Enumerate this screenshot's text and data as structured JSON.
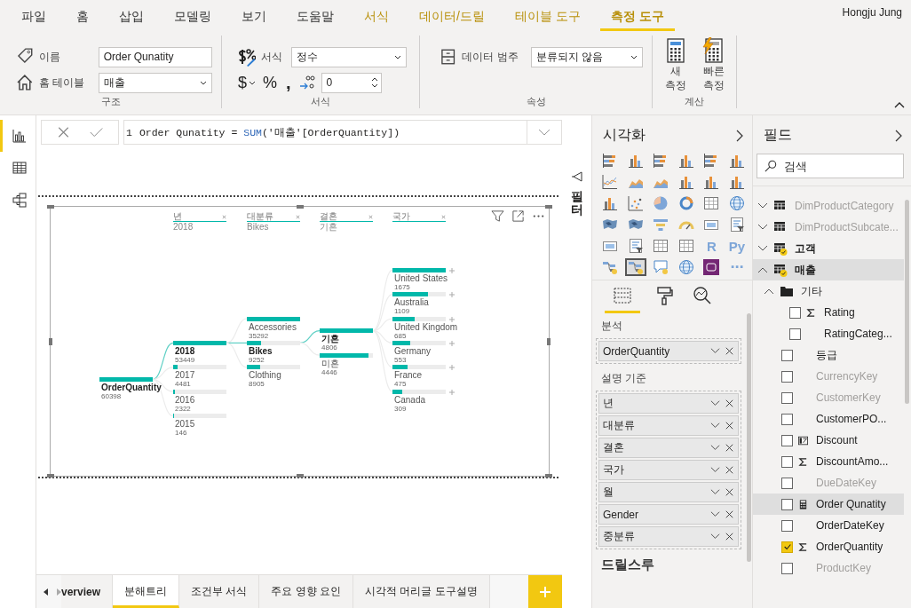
{
  "ribbon": {
    "tabs": [
      {
        "label": "파일",
        "contextual": false,
        "selected": false
      },
      {
        "label": "홈",
        "contextual": false,
        "selected": false
      },
      {
        "label": "삽입",
        "contextual": false,
        "selected": false
      },
      {
        "label": "모델링",
        "contextual": false,
        "selected": false
      },
      {
        "label": "보기",
        "contextual": false,
        "selected": false
      },
      {
        "label": "도움말",
        "contextual": false,
        "selected": false
      },
      {
        "label": "서식",
        "contextual": true,
        "selected": false
      },
      {
        "label": "데이터/드릴",
        "contextual": true,
        "selected": false
      },
      {
        "label": "테이블 도구",
        "contextual": true,
        "selected": false
      },
      {
        "label": "측정 도구",
        "contextual": true,
        "selected": true
      }
    ],
    "user": "Hongju Jung",
    "structure": {
      "label": "구조",
      "name_label": "이름",
      "name_value": "Order Qunatity",
      "home_table_label": "홈 테이블",
      "home_table_value": "매출"
    },
    "format": {
      "label": "서식",
      "format_label": "서식",
      "format_value": "정수",
      "currency": "$",
      "percent": "%",
      "comma": ",",
      "decimals_value": "0"
    },
    "properties": {
      "label": "속성",
      "category_label": "데이터 범주",
      "category_value": "분류되지 않음"
    },
    "calculations": {
      "label": "계산",
      "buttons": [
        {
          "label": "새 측정",
          "kind": "new"
        },
        {
          "label": "빠른 측정",
          "kind": "quick"
        }
      ]
    }
  },
  "left_nav": [
    {
      "kind": "report",
      "selected": true
    },
    {
      "kind": "data",
      "selected": false
    },
    {
      "kind": "model",
      "selected": false
    }
  ],
  "formula_bar": {
    "line_number": "1",
    "segments": [
      {
        "text": "Order Qunatity = ",
        "kind": "plain"
      },
      {
        "text": "SUM",
        "kind": "function"
      },
      {
        "text": "('매출'[OrderQuantity])",
        "kind": "plain"
      }
    ]
  },
  "visual": {
    "root": {
      "label": "OrderQuantity",
      "value": "60398",
      "level": 1
    },
    "columns": [
      {
        "header": "년",
        "subtitle": "2018",
        "nodes": [
          {
            "label": "2018",
            "value": "53449",
            "level": 1,
            "selected": true
          },
          {
            "label": "2017",
            "value": "4481",
            "level": 0.08,
            "selected": false
          },
          {
            "label": "2016",
            "value": "2322",
            "level": 0.04,
            "selected": false
          },
          {
            "label": "2015",
            "value": "146",
            "level": 0.005,
            "selected": false
          }
        ]
      },
      {
        "header": "대분류",
        "subtitle": "Bikes",
        "nodes": [
          {
            "label": "Accessories",
            "value": "35292",
            "level": 1,
            "selected": false
          },
          {
            "label": "Bikes",
            "value": "9252",
            "level": 0.26,
            "selected": true
          },
          {
            "label": "Clothing",
            "value": "8905",
            "level": 0.25,
            "selected": false
          }
        ]
      },
      {
        "header": "결혼",
        "subtitle": "기혼",
        "nodes": [
          {
            "label": "기혼",
            "value": "4806",
            "level": 1,
            "selected": true
          },
          {
            "label": "미혼",
            "value": "4446",
            "level": 0.92,
            "selected": false
          }
        ]
      },
      {
        "header": "국가",
        "nodes": [
          {
            "label": "United States",
            "value": "1675",
            "level": 1,
            "selected": false
          },
          {
            "label": "Australia",
            "value": "1109",
            "level": 0.66,
            "selected": false
          },
          {
            "label": "United Kingdom",
            "value": "685",
            "level": 0.41,
            "selected": false
          },
          {
            "label": "Germany",
            "value": "553",
            "level": 0.33,
            "selected": false
          },
          {
            "label": "France",
            "value": "475",
            "level": 0.28,
            "selected": false
          },
          {
            "label": "Canada",
            "value": "309",
            "level": 0.18,
            "selected": false
          }
        ]
      }
    ]
  },
  "filter_pane": {
    "label": "필터"
  },
  "visualizations": {
    "title": "시각화",
    "visuals": [
      {
        "kind": "hbar",
        "selected": false
      },
      {
        "kind": "vbar",
        "selected": false
      },
      {
        "kind": "hbar",
        "selected": false
      },
      {
        "kind": "vbar",
        "selected": false
      },
      {
        "kind": "hbar",
        "selected": false
      },
      {
        "kind": "vbar",
        "selected": false
      },
      {
        "kind": "line",
        "selected": false
      },
      {
        "kind": "area",
        "selected": false
      },
      {
        "kind": "area",
        "selected": false
      },
      {
        "kind": "vbar",
        "selected": false
      },
      {
        "kind": "vbar",
        "selected": false
      },
      {
        "kind": "vbar",
        "selected": false
      },
      {
        "kind": "vbar",
        "selected": false
      },
      {
        "kind": "dots",
        "selected": false
      },
      {
        "kind": "pie",
        "selected": false
      },
      {
        "kind": "donut",
        "selected": false
      },
      {
        "kind": "grid",
        "selected": false
      },
      {
        "kind": "globe",
        "selected": false
      },
      {
        "kind": "map",
        "selected": false
      },
      {
        "kind": "map",
        "selected": false
      },
      {
        "kind": "funnel",
        "selected": false
      },
      {
        "kind": "gauge",
        "selected": false
      },
      {
        "kind": "card",
        "selected": false
      },
      {
        "kind": "list",
        "selected": false
      },
      {
        "kind": "card",
        "selected": false
      },
      {
        "kind": "list",
        "selected": false
      },
      {
        "kind": "grid",
        "selected": false
      },
      {
        "kind": "grid",
        "selected": false
      },
      {
        "kind": "glyph",
        "label": "R",
        "selected": false
      },
      {
        "kind": "glyph",
        "label": "Py",
        "selected": false
      },
      {
        "kind": "tree",
        "selected": false
      },
      {
        "kind": "tree",
        "selected": true
      },
      {
        "kind": "bubble",
        "selected": false
      },
      {
        "kind": "globe",
        "selected": false
      },
      {
        "kind": "app",
        "selected": false
      },
      {
        "kind": "glyph",
        "label": "⋯",
        "selected": false
      }
    ],
    "pane_tabs": [
      {
        "kind": "fields",
        "selected": true
      },
      {
        "kind": "format",
        "selected": false
      },
      {
        "kind": "analytics",
        "selected": false
      }
    ],
    "analyze": {
      "label": "분석",
      "fields": [
        "OrderQuantity"
      ]
    },
    "explain_by": {
      "label": "설명 기준",
      "fields": [
        "년",
        "대분류",
        "결혼",
        "국가",
        "월",
        "Gender",
        "중분류"
      ]
    },
    "drillthrough": "드릴스루"
  },
  "fields": {
    "title": "필드",
    "search": {
      "placeholder": "검색"
    },
    "tree": [
      {
        "kind": "table",
        "name": "DimProductCategory",
        "expanded": false,
        "hidden": true,
        "used": false,
        "selected": false
      },
      {
        "kind": "table",
        "name": "DimProductSubcate...",
        "expanded": false,
        "hidden": true,
        "used": false,
        "selected": false
      },
      {
        "kind": "table",
        "name": "고객",
        "expanded": false,
        "hidden": false,
        "used": true,
        "selected": false
      },
      {
        "kind": "table",
        "name": "매출",
        "expanded": true,
        "hidden": false,
        "used": true,
        "selected": true,
        "children": [
          {
            "kind": "folder",
            "name": "기타",
            "expanded": true,
            "children": [
              {
                "kind": "sum-field",
                "name": "Rating",
                "checked": false,
                "hidden": false,
                "selected": false
              },
              {
                "kind": "field",
                "name": "RatingCateg...",
                "checked": false,
                "hidden": false,
                "selected": false
              }
            ]
          },
          {
            "kind": "field",
            "name": "등급",
            "checked": false,
            "hidden": false,
            "selected": false
          },
          {
            "kind": "field",
            "name": "CurrencyKey",
            "checked": false,
            "hidden": true,
            "selected": false
          },
          {
            "kind": "field",
            "name": "CustomerKey",
            "checked": false,
            "hidden": true,
            "selected": false
          },
          {
            "kind": "field",
            "name": "CustomerPO...",
            "checked": false,
            "hidden": false,
            "selected": false
          },
          {
            "kind": "parameter-field",
            "name": "Discount",
            "checked": false,
            "hidden": false,
            "selected": false
          },
          {
            "kind": "sum-field",
            "name": "DiscountAmo...",
            "checked": false,
            "hidden": false,
            "selected": false
          },
          {
            "kind": "field",
            "name": "DueDateKey",
            "checked": false,
            "hidden": true,
            "selected": false
          },
          {
            "kind": "measure",
            "name": "Order Qunatity",
            "checked": false,
            "hidden": false,
            "selected": true
          },
          {
            "kind": "field",
            "name": "OrderDateKey",
            "checked": false,
            "hidden": false,
            "selected": false
          },
          {
            "kind": "sum-field",
            "name": "OrderQuantity",
            "checked": true,
            "hidden": false,
            "selected": false
          },
          {
            "kind": "field",
            "name": "ProductKey",
            "checked": false,
            "hidden": true,
            "selected": false
          }
        ]
      }
    ]
  },
  "page_tabs": [
    {
      "label": "verview",
      "selected": false
    },
    {
      "label": "분해트리",
      "selected": true
    },
    {
      "label": "조건부 서식",
      "selected": false
    },
    {
      "label": "주요 영향 요인",
      "selected": false
    },
    {
      "label": "시각적 머리글 도구설명",
      "selected": false
    }
  ]
}
